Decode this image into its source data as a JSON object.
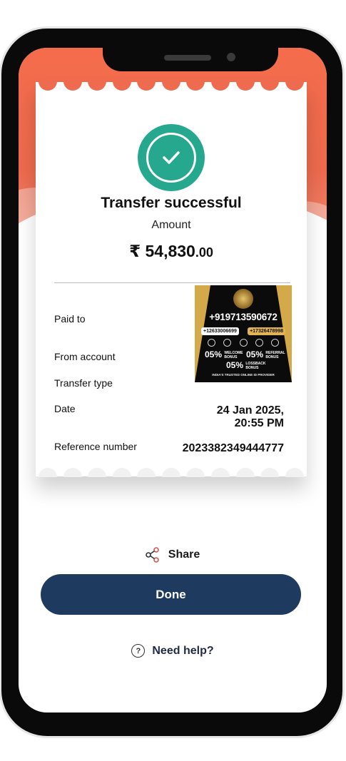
{
  "receipt": {
    "status_title": "Transfer successful",
    "amount_label": "Amount",
    "amount_main": "₹ 54,830",
    "amount_paise": ".00",
    "rows": {
      "paid_to_label": "Paid to",
      "from_account_label": "From account",
      "transfer_type_label": "Transfer type",
      "date_label": "Date",
      "date_value_line1": "24 Jan 2025,",
      "date_value_line2": "20:55 PM",
      "reference_label": "Reference number",
      "reference_value": "2023382349444777"
    }
  },
  "ad_overlay": {
    "phone_number": "+919713590672",
    "number_left": "+12633006699",
    "number_right": "+17326478998",
    "bonus_1_pct": "05%",
    "bonus_1_text": "WELCOME BONUS",
    "bonus_2_pct": "05%",
    "bonus_2_text": "REFERRAL BONUS",
    "bonus_3_pct": "05%",
    "bonus_3_text": "LOSSBACK BONUS",
    "footer": "INDIA'S TRUSTED ONLINE ID PROVIDER"
  },
  "actions": {
    "share_label": "Share",
    "done_label": "Done",
    "help_label": "Need help?",
    "help_icon_glyph": "?"
  },
  "colors": {
    "header_orange": "#ee6a4e",
    "success_green": "#26a88e",
    "done_button": "#1f3a5f"
  },
  "icons": {
    "success": "checkmark-circle-icon",
    "share": "share-icon",
    "help": "question-circle-icon"
  }
}
